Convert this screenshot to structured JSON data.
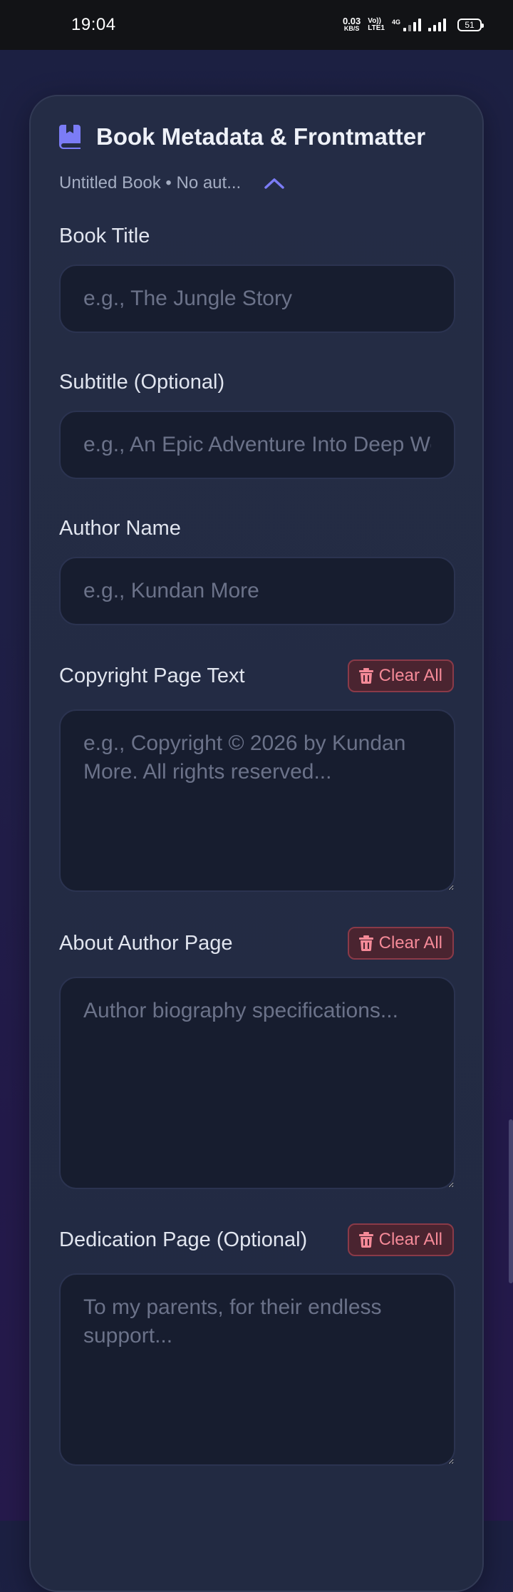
{
  "status_bar": {
    "time": "19:04",
    "net_speed_value": "0.03",
    "net_speed_unit": "KB/S",
    "volte_top": "Vo))",
    "volte_bottom": "LTE1",
    "network_type": "4G",
    "battery": "51"
  },
  "card": {
    "title": "Book Metadata & Frontmatter",
    "summary": "Untitled Book • No aut...",
    "icon": "book-icon",
    "accent_color": "#7b7cf6"
  },
  "fields": {
    "book_title": {
      "label": "Book Title",
      "placeholder": "e.g., The Jungle Story",
      "value": ""
    },
    "subtitle": {
      "label": "Subtitle (Optional)",
      "placeholder": "e.g., An Epic Adventure Into Deep Woods",
      "value": ""
    },
    "author_name": {
      "label": "Author Name",
      "placeholder": "e.g., Kundan More",
      "value": ""
    },
    "copyright": {
      "label": "Copyright Page Text",
      "placeholder": "e.g., Copyright © 2026 by Kundan More. All rights reserved...",
      "value": "",
      "clear_label": "Clear All"
    },
    "about_author": {
      "label": "About Author Page",
      "placeholder": "Author biography specifications...",
      "value": "",
      "clear_label": "Clear All"
    },
    "dedication": {
      "label": "Dedication Page (Optional)",
      "placeholder": "To my parents, for their endless support...",
      "value": "",
      "clear_label": "Clear All"
    }
  },
  "colors": {
    "danger_text": "#f58a98",
    "danger_bg": "#4a2430",
    "danger_border": "#8a3a48"
  }
}
